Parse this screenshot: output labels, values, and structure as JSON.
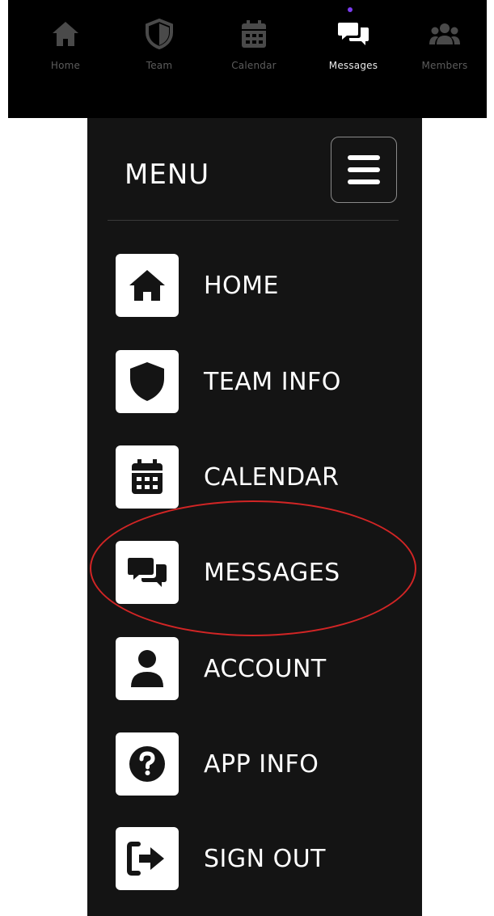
{
  "tabbar": {
    "tabs": [
      {
        "label": "Home",
        "icon": "home-icon",
        "active": false
      },
      {
        "label": "Team",
        "icon": "shield-icon",
        "active": false
      },
      {
        "label": "Calendar",
        "icon": "calendar-icon",
        "active": false
      },
      {
        "label": "Messages",
        "icon": "chat-icon",
        "active": true
      },
      {
        "label": "Members",
        "icon": "users-icon",
        "active": false
      }
    ],
    "active_indicator_color": "#7b3cf0"
  },
  "menu": {
    "title": "MENU",
    "toggle_icon": "hamburger-icon",
    "items": [
      {
        "label": "HOME",
        "icon": "home-icon"
      },
      {
        "label": "TEAM INFO",
        "icon": "shield-icon"
      },
      {
        "label": "CALENDAR",
        "icon": "calendar-icon"
      },
      {
        "label": "MESSAGES",
        "icon": "chat-icon",
        "highlighted": true
      },
      {
        "label": "ACCOUNT",
        "icon": "user-icon"
      },
      {
        "label": "APP INFO",
        "icon": "question-icon"
      },
      {
        "label": "SIGN OUT",
        "icon": "sign-out-icon"
      }
    ]
  },
  "colors": {
    "panel_bg": "#141414",
    "tabbar_bg": "#000000",
    "highlight_ring": "#d22525",
    "inactive_tab": "#5c5c5c"
  }
}
